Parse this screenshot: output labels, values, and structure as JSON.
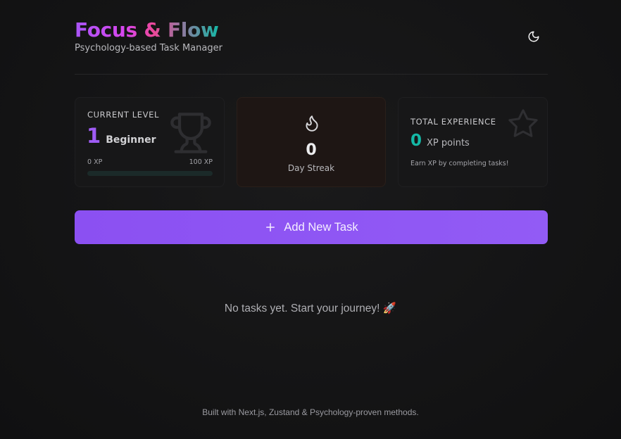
{
  "header": {
    "title": "Focus & Flow",
    "subtitle": "Psychology-based Task Manager",
    "theme_toggle_icon": "moon-icon"
  },
  "stats": {
    "level": {
      "label": "CURRENT LEVEL",
      "value": "1",
      "name": "Beginner",
      "progress_min": "0 XP",
      "progress_max": "100 XP",
      "progress_fraction": 0,
      "icon": "trophy-icon"
    },
    "streak": {
      "value": "0",
      "label": "Day Streak",
      "icon": "flame-icon"
    },
    "experience": {
      "label": "TOTAL EXPERIENCE",
      "value": "0",
      "unit": "XP points",
      "hint": "Earn XP by completing tasks!",
      "icon": "star-icon"
    }
  },
  "add_task": {
    "label": "Add New Task",
    "icon": "plus-icon"
  },
  "empty_state": "No tasks yet. Start your journey! 🚀",
  "footer": "Built with Next.js, Zustand & Psychology-proven methods.",
  "colors": {
    "accent_purple": "#9f5cf5",
    "accent_teal": "#14b8a6",
    "button": "#8b50f2"
  }
}
